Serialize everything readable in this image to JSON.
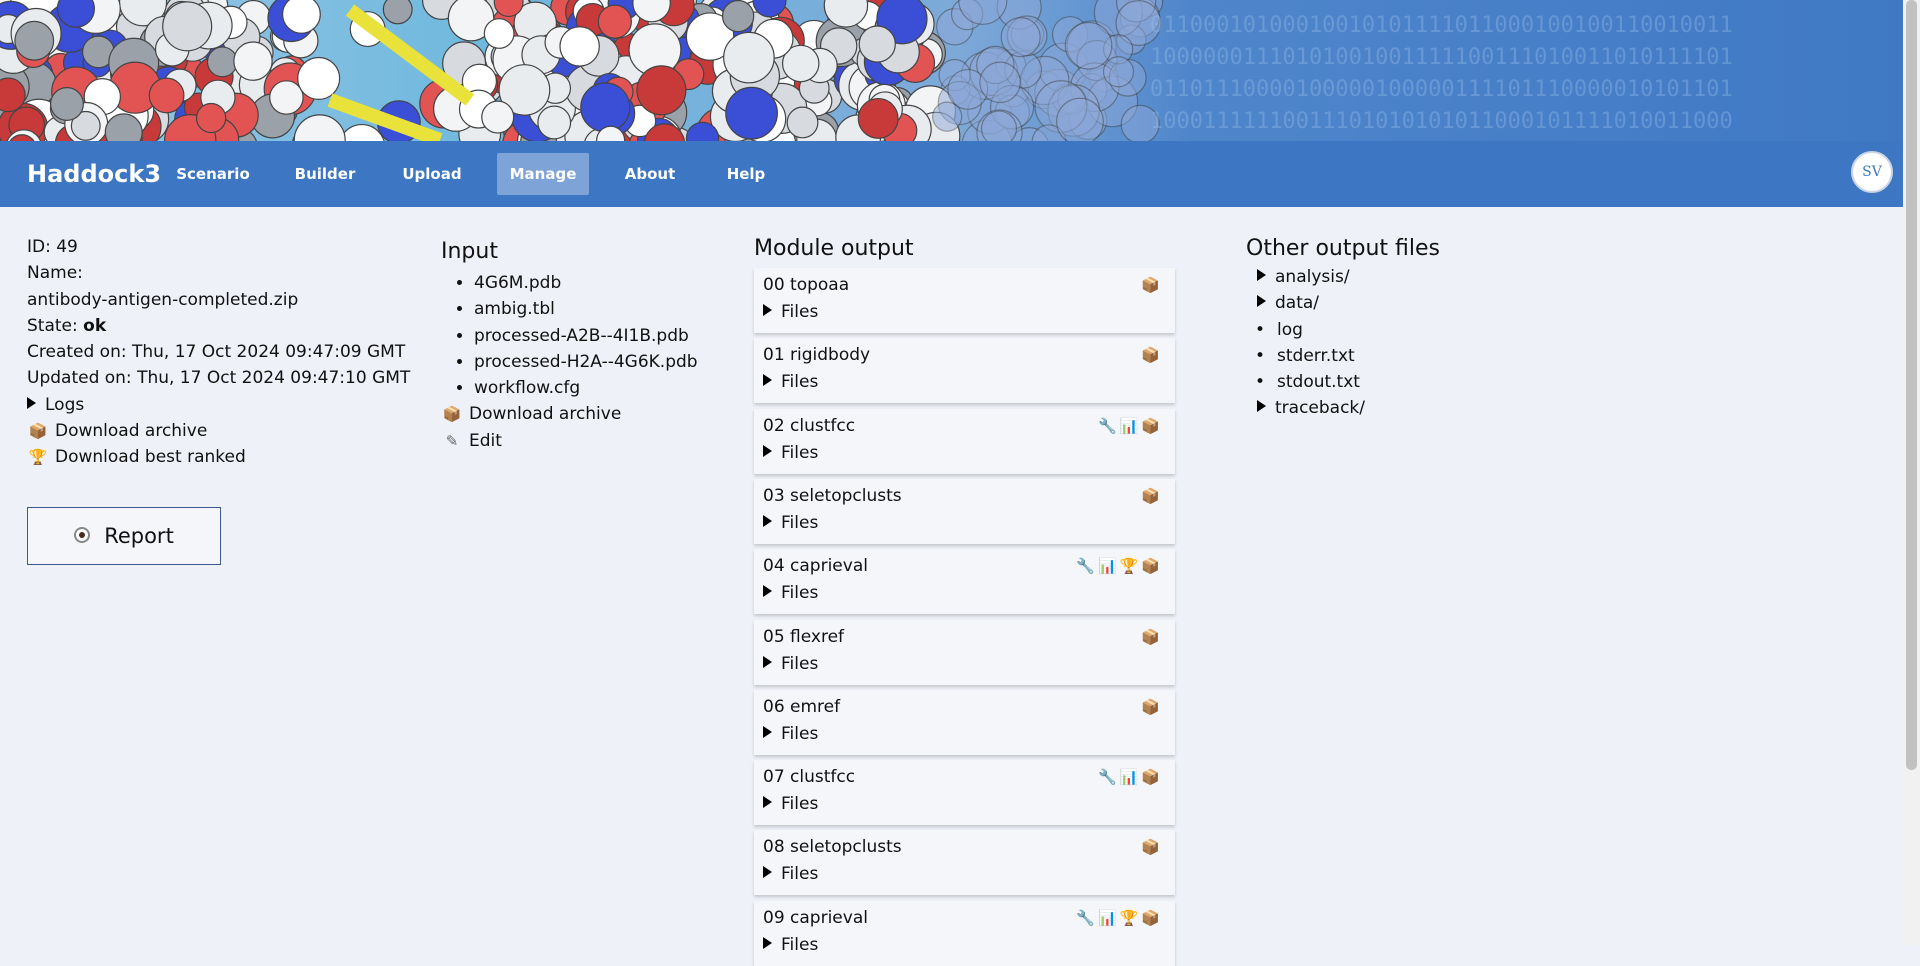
{
  "nav": {
    "brand": "Haddock3",
    "items": [
      {
        "label": "Scenario",
        "active": false
      },
      {
        "label": "Builder",
        "active": false
      },
      {
        "label": "Upload",
        "active": false
      },
      {
        "label": "Manage",
        "active": true
      },
      {
        "label": "About",
        "active": false
      },
      {
        "label": "Help",
        "active": false
      }
    ],
    "avatar_initials": "SV"
  },
  "job": {
    "id_line": "ID: 49",
    "name_label": "Name:",
    "name_value": "antibody-antigen-completed.zip",
    "state_label": "State: ",
    "state_value": "ok",
    "created": "Created on: Thu, 17 Oct 2024 09:47:09 GMT",
    "updated": "Updated on: Thu, 17 Oct 2024 09:47:10 GMT",
    "logs_label": "Logs",
    "download_archive_label": "Download archive",
    "download_best_label": "Download best ranked",
    "report_label": "Report"
  },
  "input": {
    "title": "Input",
    "files": [
      "4G6M.pdb",
      "ambig.tbl",
      "processed-A2B--4I1B.pdb",
      "processed-H2A--4G6K.pdb",
      "workflow.cfg"
    ],
    "download_label": "Download archive",
    "edit_label": "Edit"
  },
  "modules": {
    "title": "Module output",
    "files_label": "Files",
    "items": [
      {
        "name": "00 topoaa",
        "icons": [
          "box-icon"
        ]
      },
      {
        "name": "01 rigidbody",
        "icons": [
          "box-icon"
        ]
      },
      {
        "name": "02 clustfcc",
        "icons": [
          "wrench-icon",
          "chart-icon",
          "box-icon"
        ]
      },
      {
        "name": "03 seletopclusts",
        "icons": [
          "box-icon"
        ]
      },
      {
        "name": "04 caprieval",
        "icons": [
          "wrench-icon",
          "chart-icon",
          "trophy-icon",
          "box-icon"
        ]
      },
      {
        "name": "05 flexref",
        "icons": [
          "box-icon"
        ]
      },
      {
        "name": "06 emref",
        "icons": [
          "box-icon"
        ]
      },
      {
        "name": "07 clustfcc",
        "icons": [
          "wrench-icon",
          "chart-icon",
          "box-icon"
        ]
      },
      {
        "name": "08 seletopclusts",
        "icons": [
          "box-icon"
        ]
      },
      {
        "name": "09 caprieval",
        "icons": [
          "wrench-icon",
          "chart-icon",
          "trophy-icon",
          "box-icon"
        ]
      }
    ]
  },
  "other": {
    "title": "Other output files",
    "entries": [
      {
        "label": "analysis/",
        "kind": "folder"
      },
      {
        "label": "data/",
        "kind": "folder"
      },
      {
        "label": "log",
        "kind": "file"
      },
      {
        "label": "stderr.txt",
        "kind": "file"
      },
      {
        "label": "stdout.txt",
        "kind": "file"
      },
      {
        "label": "traceback/",
        "kind": "folder"
      }
    ]
  },
  "colors": {
    "nav_bg": "#3d77c3",
    "nav_active": "#7ea3d6",
    "page_bg": "#eef1f7"
  }
}
